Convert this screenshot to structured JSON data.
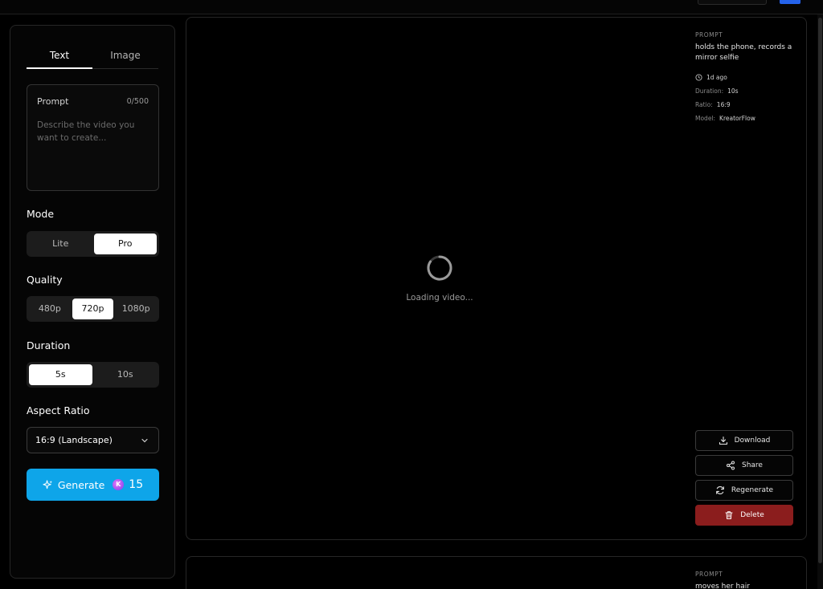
{
  "sidebar": {
    "tabs": [
      {
        "label": "Text",
        "active": true
      },
      {
        "label": "Image",
        "active": false
      }
    ],
    "prompt": {
      "label": "Prompt",
      "count": "0/500",
      "placeholder": "Describe the video you want to create...",
      "value": ""
    },
    "mode": {
      "title": "Mode",
      "options": [
        "Lite",
        "Pro"
      ],
      "selected": "Pro"
    },
    "quality": {
      "title": "Quality",
      "options": [
        "480p",
        "720p",
        "1080p"
      ],
      "selected": "720p"
    },
    "duration": {
      "title": "Duration",
      "options": [
        "5s",
        "10s"
      ],
      "selected": "5s"
    },
    "aspect": {
      "title": "Aspect Ratio",
      "value": "16:9 (Landscape)"
    },
    "generate": {
      "label": "Generate",
      "coin_letter": "K",
      "credits": "15"
    }
  },
  "video_card": {
    "loading_text": "Loading video...",
    "meta": {
      "prompt_label": "PROMPT",
      "prompt_text": "holds the phone, records a mirror selfie",
      "time_ago": "1d ago",
      "duration_label": "Duration:",
      "duration_value": "10s",
      "ratio_label": "Ratio:",
      "ratio_value": "16:9",
      "model_label": "Model:",
      "model_value": "KreatorFlow"
    },
    "actions": {
      "download": "Download",
      "share": "Share",
      "regenerate": "Regenerate",
      "delete": "Delete"
    }
  },
  "video_card_2": {
    "prompt_label": "PROMPT",
    "prompt_text": "moves her hair"
  },
  "colors": {
    "accent": "#0ea5e9",
    "danger": "#8b1d1d",
    "topbar_button": "#2563eb"
  }
}
